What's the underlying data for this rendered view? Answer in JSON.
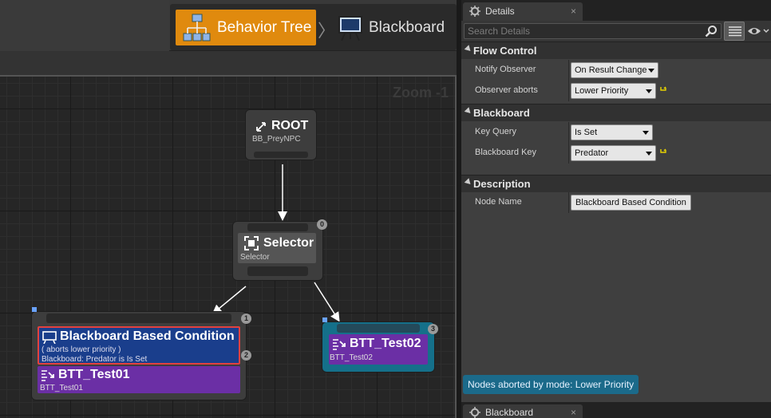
{
  "toolbar": {
    "modes": [
      {
        "label": "Behavior Tree",
        "icon": "behavior-tree-icon",
        "active": true
      },
      {
        "label": "Blackboard",
        "icon": "blackboard-monitor-icon",
        "active": false
      }
    ],
    "separator": "〉"
  },
  "graph": {
    "zoom_label": "Zoom -1",
    "nodes": {
      "root": {
        "title": "ROOT",
        "subtitle": "BB_PreyNPC"
      },
      "selector": {
        "title": "Selector",
        "subtitle": "Selector",
        "index": "0"
      },
      "sequence_left": {
        "index_top": "1",
        "decorator": {
          "title": "Blackboard Based Condition",
          "line1": "( aborts lower priority )",
          "line2": "Blackboard: Predator is Is Set",
          "index": "2"
        },
        "task": {
          "title": "BTT_Test01",
          "subtitle": "BTT_Test01"
        }
      },
      "task_right": {
        "title": "BTT_Test02",
        "subtitle": "BTT_Test02",
        "index": "3"
      }
    }
  },
  "details": {
    "tab_label": "Details",
    "close_glyph": "×",
    "search_placeholder": "Search Details",
    "categories": [
      {
        "label": "Flow Control",
        "rows": [
          {
            "name": "Notify Observer",
            "value": "On Result Change",
            "reset": false
          },
          {
            "name": "Observer aborts",
            "value": "Lower Priority",
            "reset": true
          }
        ]
      },
      {
        "label": "Blackboard",
        "rows": [
          {
            "name": "Key Query",
            "value": "Is Set",
            "reset": false
          },
          {
            "name": "Blackboard Key",
            "value": "Predator",
            "reset": true
          }
        ]
      },
      {
        "label": "Description",
        "rows": [
          {
            "name": "Node Name",
            "value": "Blackboard Based Condition",
            "reset": false
          }
        ]
      }
    ],
    "abort_note": "Nodes aborted by mode: Lower Priority"
  },
  "blackboard_tab": {
    "label": "Blackboard",
    "close_glyph": "×"
  },
  "colors": {
    "accent_orange": "#e08a0e",
    "decorator_blue": "#1a3e8c",
    "task_purple": "#6b2fa5",
    "highlight_red": "#e2413f",
    "active_node_teal": "#15708a"
  }
}
